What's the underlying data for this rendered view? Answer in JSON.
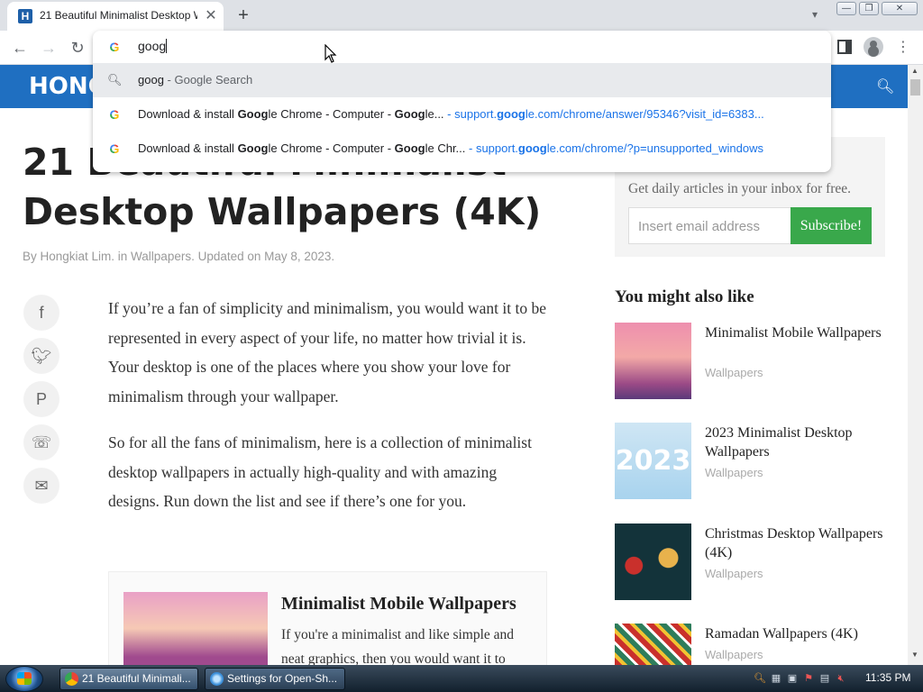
{
  "browser": {
    "tab_favicon_letter": "H",
    "tab_title": "21 Beautiful Minimalist Desktop W",
    "tab_close": "✕",
    "new_tab": "+",
    "omnibox": {
      "text": "goog",
      "suggestions": [
        {
          "icon": "search-icon",
          "bold": "goog",
          "sub": " - Google Search",
          "url": ""
        },
        {
          "icon": "google-icon",
          "title_parts": [
            "Download & install ",
            "Goog",
            "le Chrome - Computer - ",
            "Goog",
            "le..."
          ],
          "url_parts": [
            "  - support.",
            "goog",
            "le.com/chrome/answer/95346?visit_id=6383..."
          ]
        },
        {
          "icon": "google-icon",
          "title_parts": [
            "Download & install ",
            "Goog",
            "le Chrome - Computer - ",
            "Goog",
            "le Chr..."
          ],
          "url_parts": [
            "  - support.",
            "goog",
            "le.com/chrome/?p=unsupported_windows"
          ]
        }
      ]
    }
  },
  "site": {
    "logo": "HONG"
  },
  "article": {
    "title": "21 Beautiful Minimalist Desktop Wallpapers (4K)",
    "byline": "By Hongkiat Lim. in Wallpapers. Updated on May 8, 2023.",
    "paragraphs": [
      "If you’re a fan of simplicity and minimalism, you would want it to be represented in every aspect of your life, no matter how trivial it is. Your desktop is one of the places where you show your love for minimalism through your wallpaper.",
      "So for all the fans of minimalism, here is a collection of minimalist desktop wallpapers in actually high-quality and with amazing designs. Run down the list and see if there’s one for you."
    ],
    "related": {
      "title": "Minimalist Mobile Wallpapers",
      "desc": "If you're a minimalist and like simple and neat graphics, then you would want it to"
    }
  },
  "sidebar": {
    "newsletter_text": "Get daily articles in your inbox for free.",
    "email_placeholder": "Insert email address",
    "subscribe_label": "Subscribe!",
    "heading": "You might also like",
    "items": [
      {
        "title": "Minimalist Mobile Wallpapers",
        "category": "Wallpapers"
      },
      {
        "title": "2023 Minimalist Desktop Wallpapers",
        "category": "Wallpapers",
        "thumb_text": "2023"
      },
      {
        "title": "Christmas Desktop Wallpapers (4K)",
        "category": "Wallpapers"
      },
      {
        "title": "Ramadan Wallpapers (4K)",
        "category": "Wallpapers"
      }
    ]
  },
  "taskbar": {
    "tasks": [
      {
        "label": "21 Beautiful Minimali..."
      },
      {
        "label": "Settings for Open-Sh..."
      }
    ],
    "clock": "11:35 PM"
  },
  "colors": {
    "site_header": "#1f6fc1",
    "subscribe": "#39a84b",
    "link": "#1a73e8"
  }
}
